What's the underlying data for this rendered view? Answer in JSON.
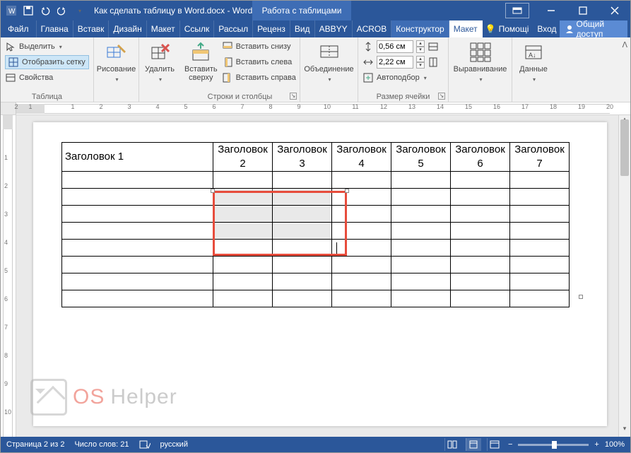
{
  "titlebar": {
    "doc_title": "Как сделать таблицу в Word.docx - Word",
    "context_tool": "Работа с таблицами"
  },
  "tabs": {
    "file": "Файл",
    "items": [
      "Главна",
      "Вставк",
      "Дизайн",
      "Макет",
      "Ссылк",
      "Рассыл",
      "Реценз",
      "Вид",
      "ABBYY",
      "ACROB"
    ],
    "contextual": [
      "Конструктор",
      "Макет"
    ],
    "active_index_contextual": 1,
    "tell_me": "Помощі",
    "signin": "Вход",
    "share": "Общий доступ"
  },
  "ribbon": {
    "table_group": {
      "label": "Таблица",
      "select": "Выделить",
      "gridlines": "Отобразить сетку",
      "properties": "Свойства"
    },
    "draw_group": {
      "draw": "Рисование"
    },
    "delete": "Удалить",
    "insert_above": "Вставить сверху",
    "rows_cols_group": {
      "label": "Строки и столбцы",
      "below": "Вставить снизу",
      "left": "Вставить слева",
      "right": "Вставить справа"
    },
    "merge_group": {
      "label": "Объединение"
    },
    "cellsize_group": {
      "label": "Размер ячейки",
      "height": "0,56 см",
      "width": "2,22 см",
      "autofit": "Автоподбор"
    },
    "align_group": {
      "label": "Выравнивание"
    },
    "data_group": {
      "label": "Данные"
    }
  },
  "ruler": {
    "numbers_h": [
      "2",
      "1",
      "",
      "1",
      "2",
      "3",
      "4",
      "5",
      "6",
      "7",
      "8",
      "9",
      "10",
      "11",
      "12",
      "13",
      "14",
      "15",
      "16",
      "17",
      "18",
      "19",
      "20"
    ],
    "numbers_v": [
      "",
      "1",
      "2",
      "3",
      "4",
      "5",
      "6",
      "7",
      "8",
      "9",
      "10"
    ]
  },
  "document": {
    "headers": [
      "Заголовок 1",
      "Заголовок 2",
      "Заголовок 3",
      "Заголовок 4",
      "Заголовок 5",
      "Заголовок 6",
      "Заголовок 7"
    ],
    "body_rows": 8,
    "cols": 7
  },
  "status": {
    "page": "Страница 2 из 2",
    "words": "Число слов: 21",
    "lang": "русский",
    "zoom": "100%"
  },
  "watermark": {
    "t1": "OS",
    "t2": " Helper"
  }
}
